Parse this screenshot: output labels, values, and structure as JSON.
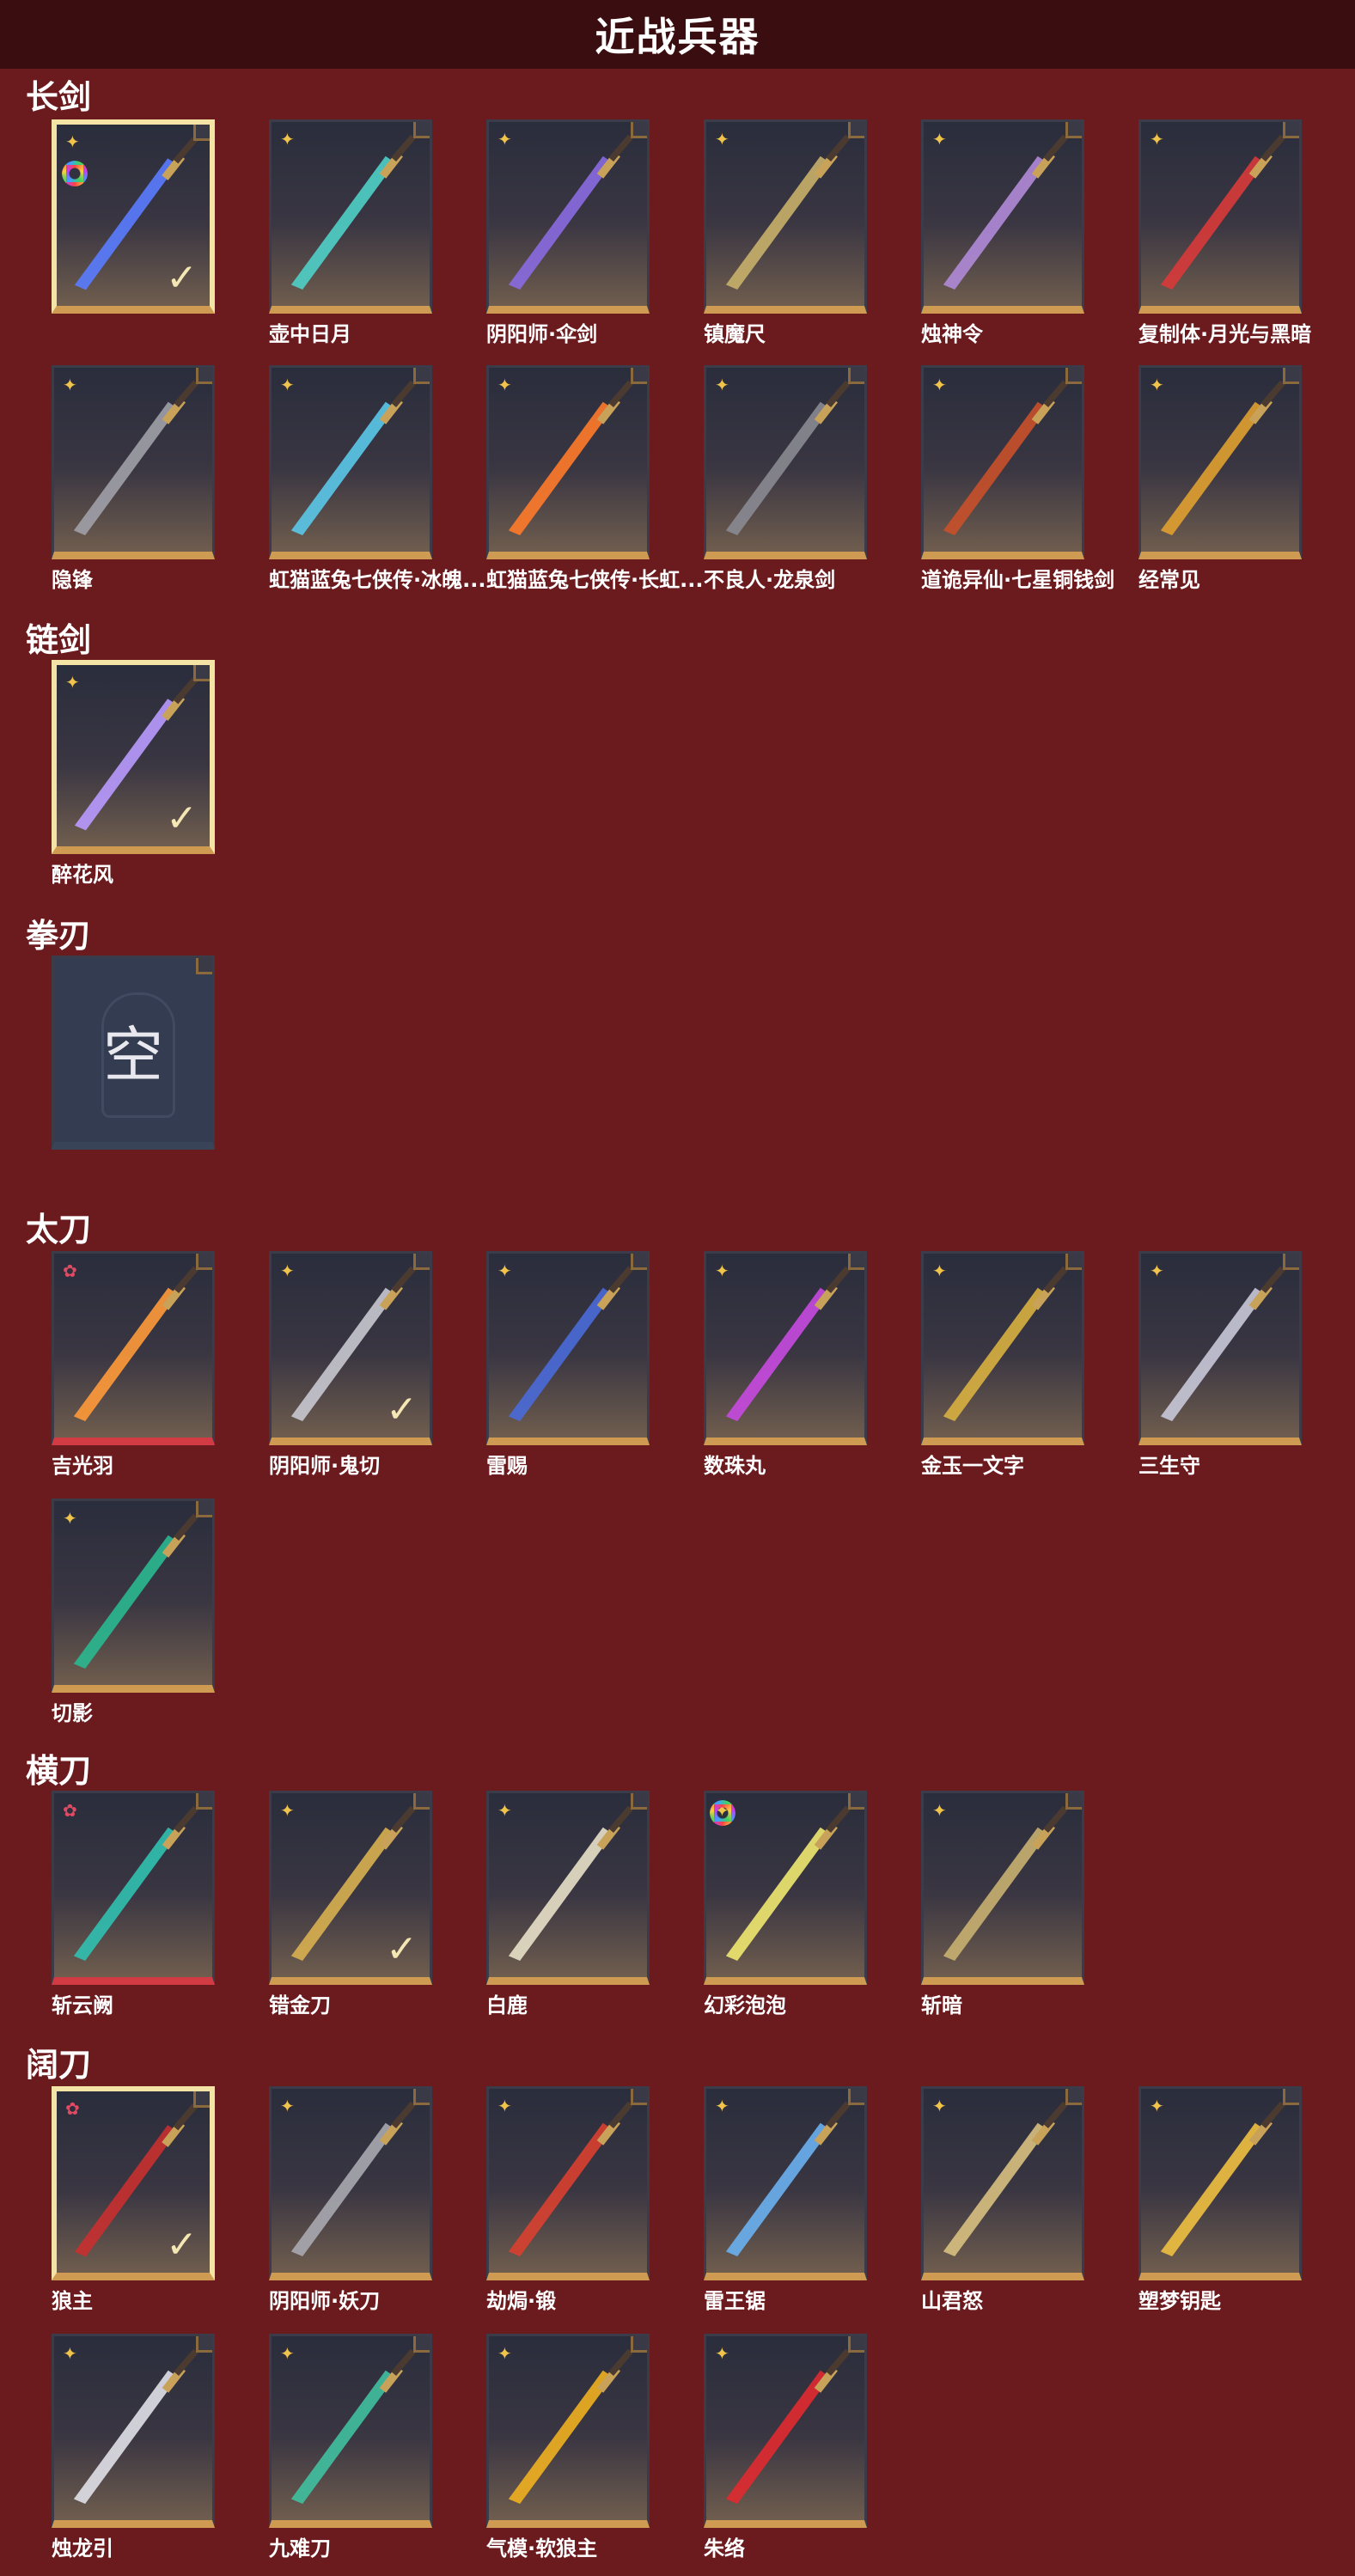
{
  "page": {
    "title": "近战兵器"
  },
  "colors": {
    "background": "#6b1a1e",
    "header": "#3a0d10",
    "gold_bar": "#cf9a52",
    "red_bar": "#d23a44",
    "selected_border": "#f3e4a6"
  },
  "sections": [
    {
      "label": "长剑"
    },
    {
      "label": "链剑"
    },
    {
      "label": "拳刃"
    },
    {
      "label": "太刀"
    },
    {
      "label": "横刀"
    },
    {
      "label": "阔刀"
    }
  ],
  "weapons": [
    {
      "name": "",
      "rarity": "gold",
      "selected": true,
      "rainbow": true,
      "color": "#5a7cff",
      "icon": "sword-icon"
    },
    {
      "name": "壶中日月",
      "rarity": "gold",
      "color": "#4fd0c8",
      "icon": "sword-icon"
    },
    {
      "name": "阴阳师·伞剑",
      "rarity": "gold",
      "color": "#8a6ae0",
      "icon": "umbrella-sword-icon"
    },
    {
      "name": "镇魔尺",
      "rarity": "gold",
      "color": "#c8b06a",
      "icon": "sword-icon"
    },
    {
      "name": "烛神令",
      "rarity": "gold",
      "color": "#b08ad8",
      "icon": "sword-icon"
    },
    {
      "name": "复制体·月光与黑暗",
      "rarity": "gold",
      "color": "#d83a3a",
      "icon": "sword-icon"
    },
    {
      "name": "隐锋",
      "rarity": "gold",
      "color": "#a0a0a8",
      "icon": "sword-icon"
    },
    {
      "name": "虹猫蓝兔七侠传·冰魄...",
      "rarity": "gold",
      "color": "#5ac8e8",
      "icon": "sword-icon"
    },
    {
      "name": "虹猫蓝兔七侠传·长虹...",
      "rarity": "gold",
      "color": "#ff7a2a",
      "icon": "sword-icon"
    },
    {
      "name": "不良人·龙泉剑",
      "rarity": "gold",
      "color": "#8a8a92",
      "icon": "sword-icon"
    },
    {
      "name": "道诡异仙·七星铜钱剑",
      "rarity": "gold",
      "color": "#c8502a",
      "icon": "sword-icon"
    },
    {
      "name": "经常见",
      "rarity": "gold",
      "color": "#e0a030",
      "icon": "sword-icon"
    },
    {
      "name": "醉花风",
      "rarity": "gold",
      "selected": true,
      "color": "#b89aff",
      "icon": "chain-sword-icon"
    },
    {
      "name": "",
      "empty": true,
      "empty_text": "空",
      "icon": "empty-slot-icon"
    },
    {
      "name": "吉光羽",
      "rarity": "pink",
      "red": true,
      "color": "#ff9a3a",
      "icon": "katana-icon"
    },
    {
      "name": "阴阳师·鬼切",
      "rarity": "gold",
      "selected_check": true,
      "color": "#c8c8d0",
      "icon": "katana-icon"
    },
    {
      "name": "雷赐",
      "rarity": "gold",
      "color": "#4a6ad8",
      "icon": "katana-icon"
    },
    {
      "name": "数珠丸",
      "rarity": "gold",
      "color": "#c84ae0",
      "icon": "katana-icon"
    },
    {
      "name": "金玉一文字",
      "rarity": "gold",
      "color": "#d8b040",
      "icon": "katana-icon"
    },
    {
      "name": "三生守",
      "rarity": "gold",
      "color": "#c8c8d8",
      "icon": "katana-icon"
    },
    {
      "name": "切影",
      "rarity": "gold",
      "color": "#2ab890",
      "icon": "katana-icon"
    },
    {
      "name": "斩云阙",
      "rarity": "pink",
      "red": true,
      "color": "#30c0b0",
      "icon": "blade-icon"
    },
    {
      "name": "错金刀",
      "rarity": "gold",
      "selected_check": true,
      "color": "#d8b050",
      "icon": "blade-icon"
    },
    {
      "name": "白鹿",
      "rarity": "gold",
      "color": "#e8e0c8",
      "icon": "blade-icon"
    },
    {
      "name": "幻彩泡泡",
      "rarity": "gold",
      "rainbow_top": true,
      "color": "#f0e870",
      "icon": "bubble-wand-icon"
    },
    {
      "name": "斩暗",
      "rarity": "gold",
      "color": "#c8b070",
      "icon": "blade-icon"
    },
    {
      "name": "狼主",
      "rarity": "pink",
      "selected": true,
      "color": "#c83030",
      "icon": "broadsword-icon"
    },
    {
      "name": "阴阳师·妖刀",
      "rarity": "gold",
      "color": "#a8a8b0",
      "icon": "broadsword-icon"
    },
    {
      "name": "劫焗·锻",
      "rarity": "gold",
      "color": "#d84030",
      "icon": "broadsword-icon"
    },
    {
      "name": "雷王锯",
      "rarity": "gold",
      "color": "#6ab0f0",
      "icon": "broadsword-icon"
    },
    {
      "name": "山君怒",
      "rarity": "gold",
      "color": "#d8c080",
      "icon": "broadsword-icon"
    },
    {
      "name": "塑梦钥匙",
      "rarity": "gold",
      "color": "#f0c040",
      "icon": "broadsword-icon"
    },
    {
      "name": "烛龙引",
      "rarity": "gold",
      "color": "#e0e0e8",
      "icon": "broadsword-icon"
    },
    {
      "name": "九难刀",
      "rarity": "gold",
      "color": "#40c0a0",
      "icon": "broadsword-icon"
    },
    {
      "name": "气模·软狼主",
      "rarity": "gold",
      "color": "#f0b020",
      "icon": "broadsword-icon"
    },
    {
      "name": "朱络",
      "rarity": "gold",
      "color": "#e02a30",
      "icon": "broadsword-icon"
    }
  ]
}
